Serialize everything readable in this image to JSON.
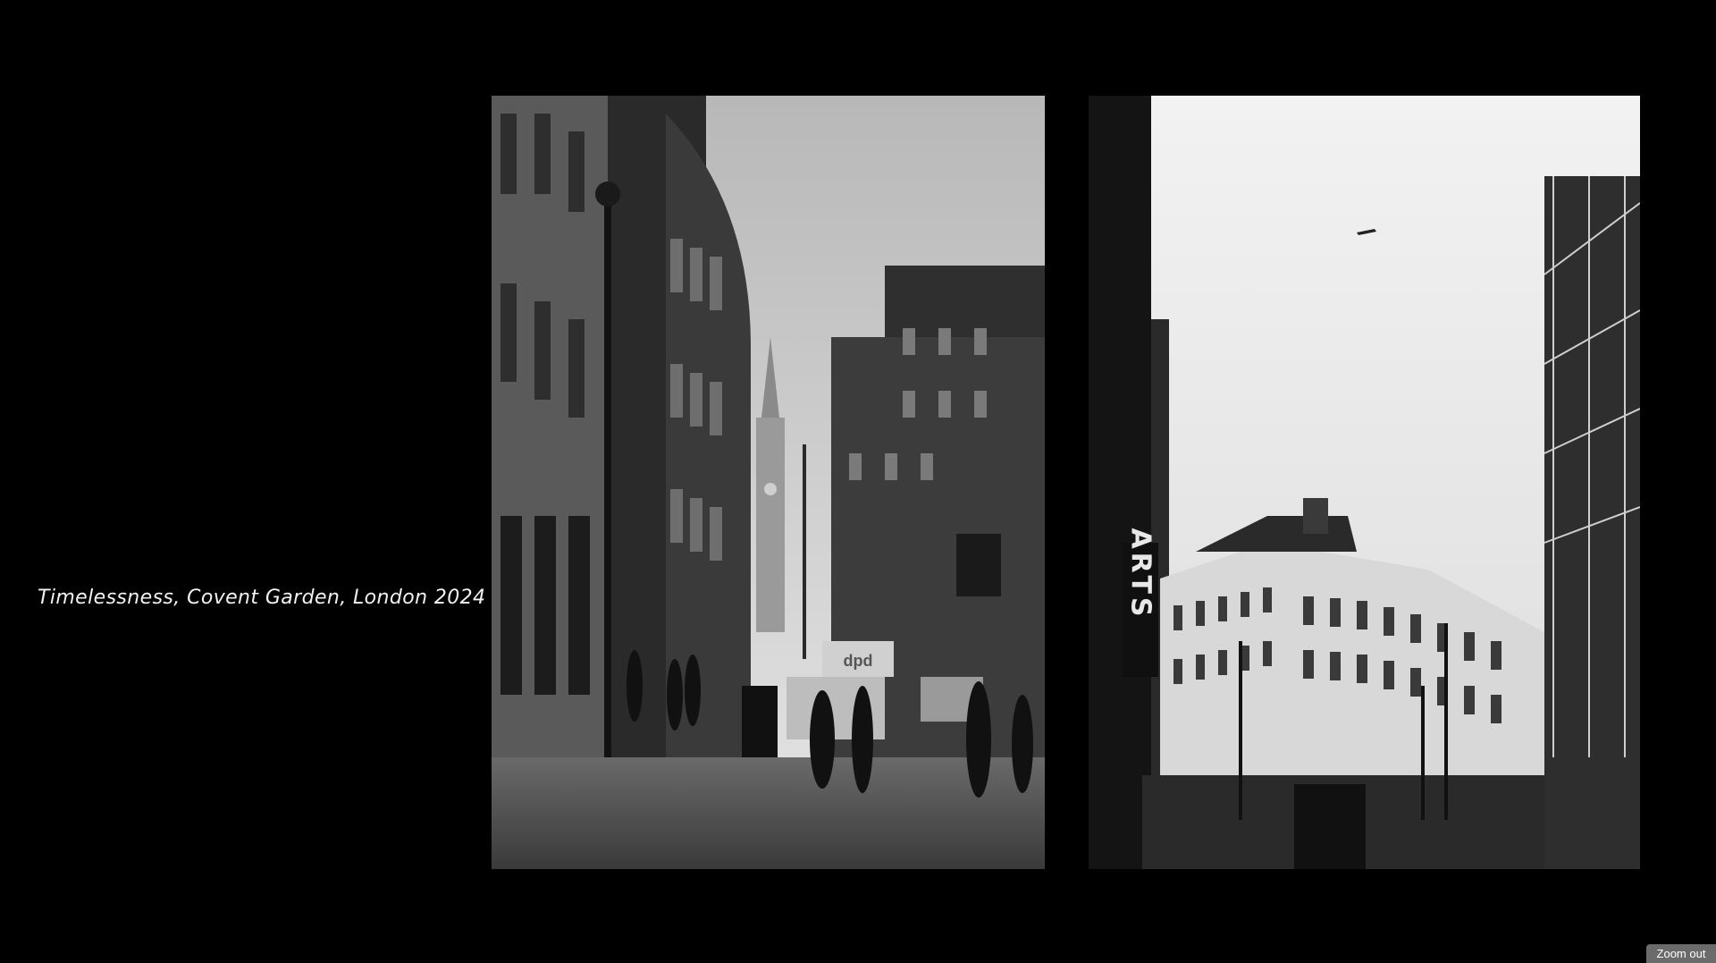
{
  "gallery": {
    "caption": "Timelessness, Covent Garden, London 2024",
    "photos": [
      {
        "name": "photo-street-corner"
      },
      {
        "name": "photo-arts-building"
      }
    ],
    "signs": {
      "arts_vertical": "ARTS",
      "dpd": "dpd"
    }
  },
  "controls": {
    "zoom_label": "Zoom out"
  }
}
